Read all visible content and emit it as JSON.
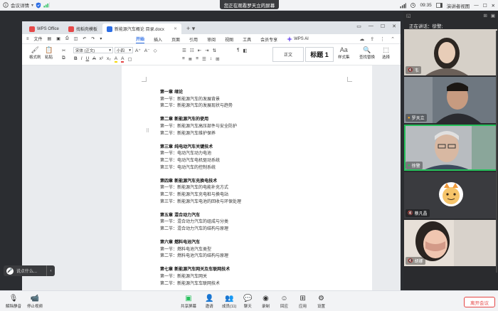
{
  "meeting": {
    "app_title": "会议详情",
    "screen_banner": "您正在观看罗天立的屏幕",
    "time": "09:35",
    "view_mode": "演讲者视图",
    "speaking_label": "正在讲话：",
    "speaking_name": "徐警;",
    "participants": [
      {
        "name": "韦"
      },
      {
        "name": "罗天立"
      },
      {
        "name": "徐警"
      },
      {
        "name": "蔡凡晶"
      },
      {
        "name": "胡娜"
      }
    ],
    "toolbar": {
      "mute": "解除静音",
      "video": "停止视频",
      "share": "共享屏幕",
      "invite": "邀请",
      "members": "成员(11)",
      "chat": "聊天",
      "record": "录制",
      "playback": "回应",
      "apps": "应用",
      "settings": "设置",
      "leave": "离开会议"
    },
    "search_pill": "说点什么..."
  },
  "wps": {
    "tabs": [
      {
        "label": "WPS Office",
        "color": "#e64848"
      },
      {
        "label": "找稻壳模板",
        "color": "#e64848"
      },
      {
        "label": "新能源汽车概论 目录.docx",
        "color": "#2b6de5"
      }
    ],
    "menu_file": "文件",
    "menu_items": [
      "开始",
      "插入",
      "页面",
      "引用",
      "审阅",
      "视图",
      "工具",
      "会员专享"
    ],
    "wps_ai": "WPS AI",
    "ribbon": {
      "format_painter": "格式刷",
      "paste": "粘贴",
      "font_name": "宋体 (正文)",
      "font_size": "小四",
      "style_normal": "正文",
      "style_heading": "标题 1",
      "styles": "样式集",
      "find_replace": "查找替换",
      "select": "选择"
    }
  },
  "document": {
    "chapters": [
      {
        "title": "第一章  绪论",
        "sections": [
          "第一节：新能源汽车的发展背景",
          "第二节：新能源汽车的发展现状与趋势"
        ]
      },
      {
        "title": "第二章  新能源汽车的使用",
        "sections": [
          "第一节：新能源汽车高压部件与安全防护",
          "第二节：新能源汽车维护保养"
        ]
      },
      {
        "title": "第三章  纯电动汽车关键技术",
        "sections": [
          "第一节：电动汽车动力电池",
          "第二节：电动汽车电机驱动系统",
          "第三节：电动汽车的控制系统"
        ]
      },
      {
        "title": "第四章  新能源汽车充换电技术",
        "sections": [
          "第一节：新能源汽车的电能补充方式",
          "第二节：新能源汽车充电桩与换电站",
          "第三节：新能源汽车电池的回收与环保处理"
        ]
      },
      {
        "title": "第五章  混合动力汽车",
        "sections": [
          "第一节：混合动力汽车的组成与分类",
          "第二节：混合动力汽车的结构与原理"
        ]
      },
      {
        "title": "第六章  燃料电池汽车",
        "sections": [
          "第一节：燃料电池汽车类型",
          "第二节：燃料电池汽车的结构与原理"
        ]
      },
      {
        "title": "第七章  新能源汽车网关及车联网技术",
        "sections": [
          "第一节：新能源汽车网关",
          "第二节：新能源汽车车联网技术"
        ]
      }
    ]
  },
  "colors": {
    "accent": "#2b6de5",
    "speaker_border": "#26c05b",
    "leave": "#e54545"
  }
}
